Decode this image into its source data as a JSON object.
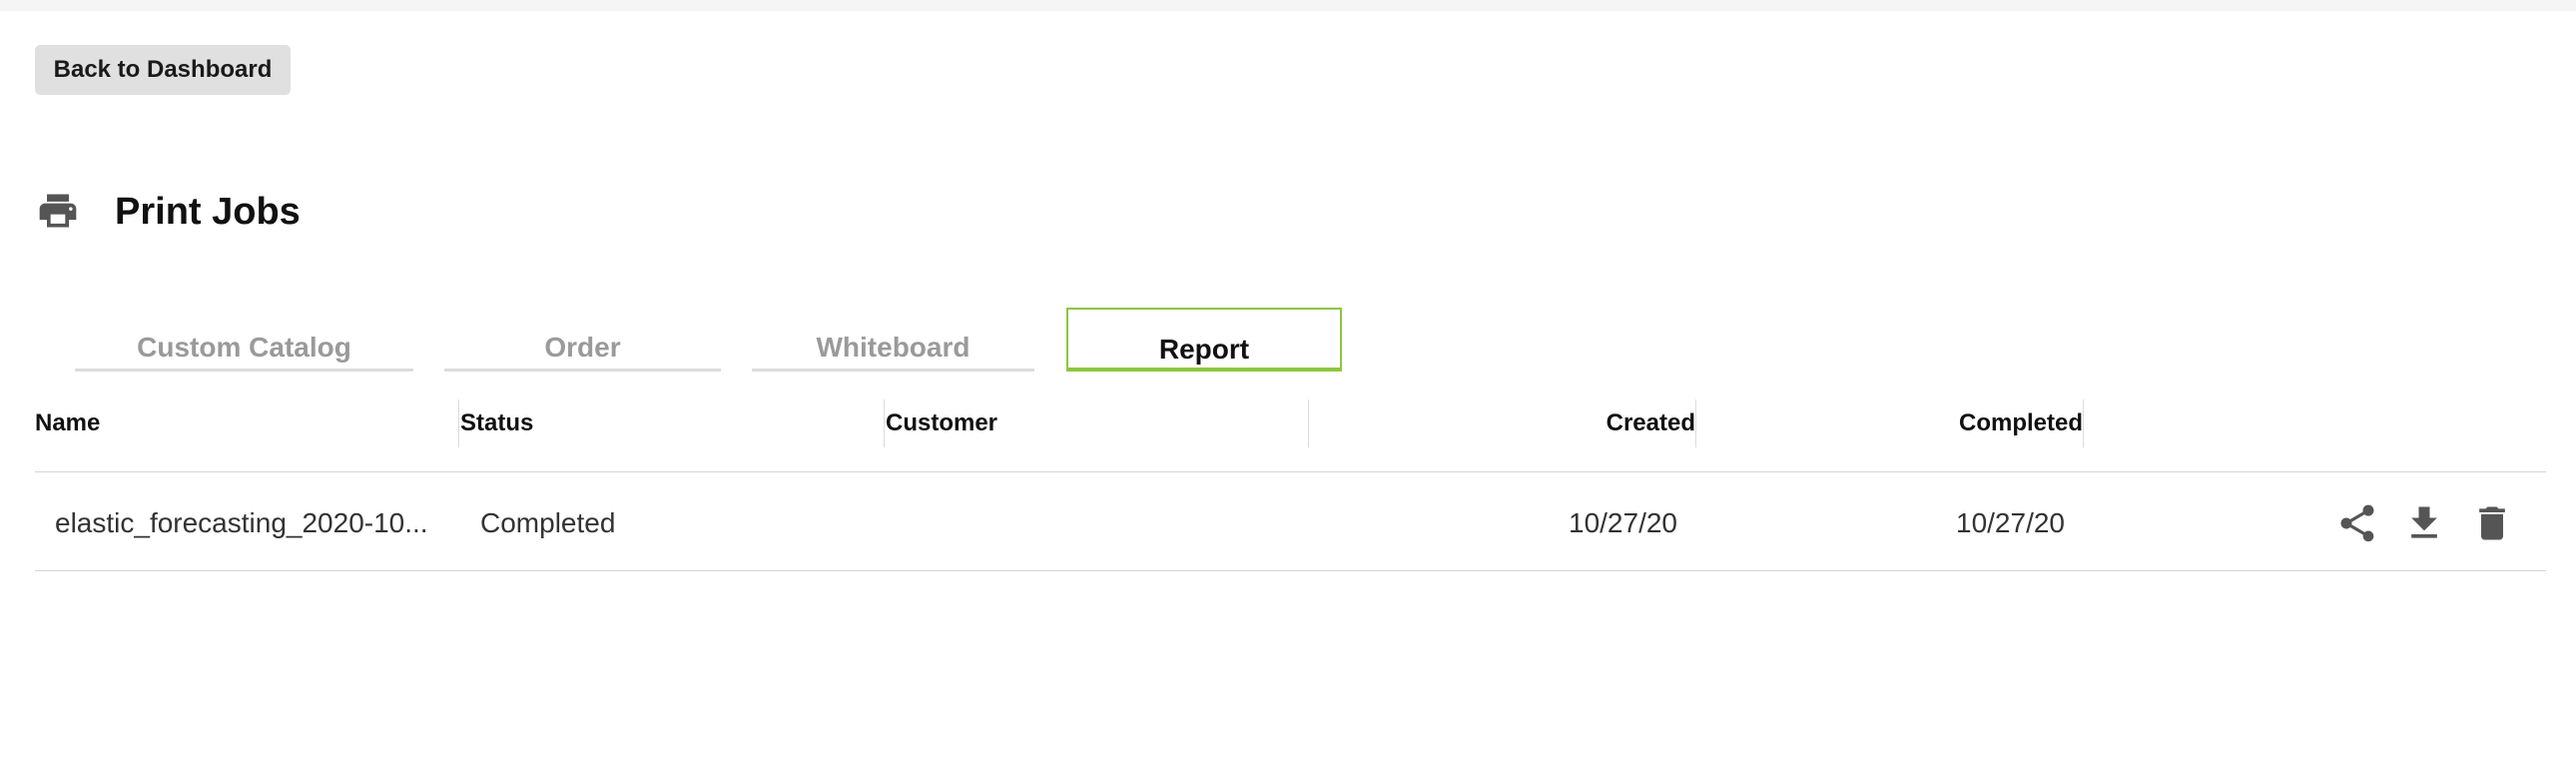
{
  "back_button": {
    "label": "Back to Dashboard"
  },
  "header": {
    "title": "Print Jobs",
    "icon": "printer-icon"
  },
  "tabs": [
    {
      "label": "Custom Catalog",
      "active": false
    },
    {
      "label": "Order",
      "active": false
    },
    {
      "label": "Whiteboard",
      "active": false
    },
    {
      "label": "Report",
      "active": true
    }
  ],
  "table": {
    "columns": [
      "Name",
      "Status",
      "Customer",
      "Created",
      "Completed"
    ],
    "rows": [
      {
        "name": "elastic_forecasting_2020-10...",
        "status": "Completed",
        "customer": "",
        "created": "10/27/20",
        "completed": "10/27/20",
        "actions": [
          "share-icon",
          "download-icon",
          "delete-icon"
        ]
      }
    ]
  },
  "colors": {
    "accent": "#8dc63f",
    "button_bg": "#e0e0e0",
    "tab_inactive": "#9a9a9a",
    "icon": "#555555"
  }
}
